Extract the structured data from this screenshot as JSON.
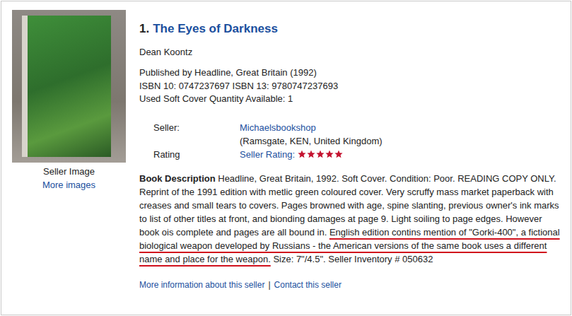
{
  "listing": {
    "number": "1.",
    "title": "The Eyes of Darkness",
    "author": "Dean Koontz",
    "details": [
      "Published by Headline, Great Britain (1992)",
      "ISBN 10: 0747237697 ISBN 13: 9780747237693",
      "Used Soft Cover Quantity Available: 1"
    ]
  },
  "image": {
    "caption": "Seller Image",
    "link": "More images"
  },
  "seller": {
    "label": "Seller:",
    "name": "Michaelsbookshop",
    "location": "(Ramsgate, KEN, United Kingdom)",
    "rating_label": "Rating",
    "rating_link": "Seller Rating:",
    "stars": 5
  },
  "description": {
    "label": "Book Description",
    "text": "Headline, Great Britain, 1992. Soft Cover. Condition: Poor. READING COPY ONLY. Reprint of the 1991 edition with metlic green coloured cover. Very scruffy mass market paperback with creases and small tears to covers. Pages browned with age, spine slanting, previous owner's ink marks to list of other titles at front, and bionding damages at page 9. Light soiling to page edges. However book ois complete and pages are all bound in.",
    "highlighted": "English edition contins mention of \"Gorki-400\", a fictional biological weapon developed by Russians - the American versions of the same book uses a different name and place for the weapon.",
    "text_after": "Size: 7\"/4.5\". Seller Inventory # 050632"
  },
  "footer": {
    "links": [
      "More information about this seller",
      "Contact this seller"
    ],
    "separator": "|"
  }
}
